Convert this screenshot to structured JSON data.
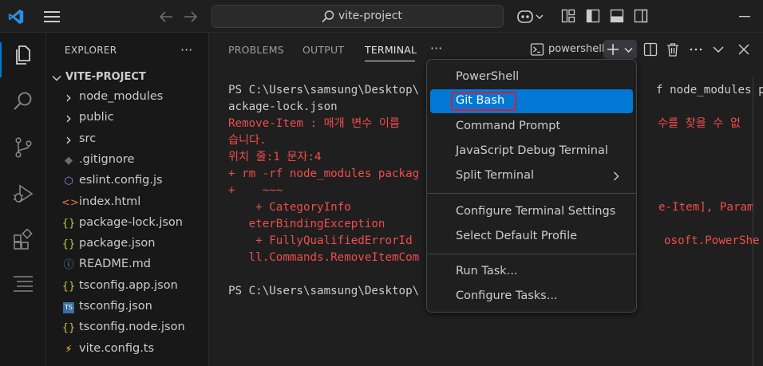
{
  "titlebar": {
    "search_text": "vite-project",
    "icons": [
      "vscode-logo-icon",
      "menu-icon",
      "back-arrow-icon",
      "forward-arrow-icon",
      "search-icon",
      "copilot-icon",
      "customize-layout-icon",
      "toggle-primary-sidebar-icon",
      "toggle-panel-icon",
      "toggle-secondary-sidebar-icon",
      "minimize-icon"
    ]
  },
  "activitybar": {
    "items": [
      "explorer-icon",
      "search-icon",
      "source-control-icon",
      "run-debug-icon",
      "extensions-icon",
      "outline-icon"
    ]
  },
  "sidebar": {
    "title": "EXPLORER",
    "more": "···",
    "project": "VITE-PROJECT",
    "files": [
      {
        "label": "node_modules",
        "icon": "chevron-right-icon",
        "glyph": "›",
        "color": "#cccccc"
      },
      {
        "label": "public",
        "icon": "chevron-right-icon",
        "glyph": "›",
        "color": "#cccccc"
      },
      {
        "label": "src",
        "icon": "chevron-right-icon",
        "glyph": "›",
        "color": "#cccccc"
      },
      {
        "label": ".gitignore",
        "icon": "git-icon",
        "glyph": "◆",
        "color": "#6d6d6d"
      },
      {
        "label": "eslint.config.js",
        "icon": "eslint-icon",
        "glyph": "⬡",
        "color": "#b07fe8"
      },
      {
        "label": "index.html",
        "icon": "html-icon",
        "glyph": "<>",
        "color": "#e37933"
      },
      {
        "label": "package-lock.json",
        "icon": "json-icon",
        "glyph": "{}",
        "color": "#cbcb41"
      },
      {
        "label": "package.json",
        "icon": "json-icon",
        "glyph": "{}",
        "color": "#cbcb41"
      },
      {
        "label": "README.md",
        "icon": "info-icon",
        "glyph": "ⓘ",
        "color": "#519aba"
      },
      {
        "label": "tsconfig.app.json",
        "icon": "json-icon",
        "glyph": "{}",
        "color": "#cbcb41"
      },
      {
        "label": "tsconfig.json",
        "icon": "typescript-icon",
        "glyph": "TS",
        "color": "#519aba"
      },
      {
        "label": "tsconfig.node.json",
        "icon": "json-icon",
        "glyph": "{}",
        "color": "#cbcb41"
      },
      {
        "label": "vite.config.ts",
        "icon": "vite-icon",
        "glyph": "⚡",
        "color": "#ffcf33"
      }
    ]
  },
  "panel": {
    "tabs": [
      "PROBLEMS",
      "OUTPUT",
      "TERMINAL"
    ],
    "more": "···",
    "terminal_name": "powershell"
  },
  "terminal": {
    "lines": [
      {
        "text": "PS C:\\Users\\samsung\\Desktop\\",
        "color": "white"
      },
      {
        "text": "ackage-lock.json",
        "color": "white"
      },
      {
        "text": "Remove-Item : 매개 변수 이름",
        "color": "red"
      },
      {
        "text": "습니다.",
        "color": "red"
      },
      {
        "text": "위치 줄:1 문자:4",
        "color": "red"
      },
      {
        "text": "+ rm -rf node_modules packag",
        "color": "red"
      },
      {
        "text": "+    ~~~",
        "color": "red"
      },
      {
        "text": "    + CategoryInfo",
        "color": "red"
      },
      {
        "text": "   eterBindingException",
        "color": "red"
      },
      {
        "text": "    + FullyQualifiedErrorId",
        "color": "red"
      },
      {
        "text": "   ll.Commands.RemoveItemCom",
        "color": "red"
      },
      {
        "text": "",
        "color": "white"
      },
      {
        "text": "PS C:\\Users\\samsung\\Desktop\\",
        "color": "white"
      }
    ],
    "right_fragments": [
      {
        "text": "f node_modules p",
        "color": "white"
      },
      {
        "text": "수를 찾을 수 없",
        "color": "red"
      },
      {
        "text": "e-Item], Param",
        "color": "red"
      },
      {
        "text": "osoft.PowerShe",
        "color": "red"
      }
    ]
  },
  "dropdown": {
    "items": [
      "PowerShell",
      "Git Bash",
      "Command Prompt",
      "JavaScript Debug Terminal",
      "Split Terminal"
    ],
    "items2": [
      "Configure Terminal Settings",
      "Select Default Profile"
    ],
    "items3": [
      "Run Task...",
      "Configure Tasks..."
    ],
    "selected": "Git Bash",
    "highlight_color": "#d81b36",
    "accent": "#0078d4"
  }
}
